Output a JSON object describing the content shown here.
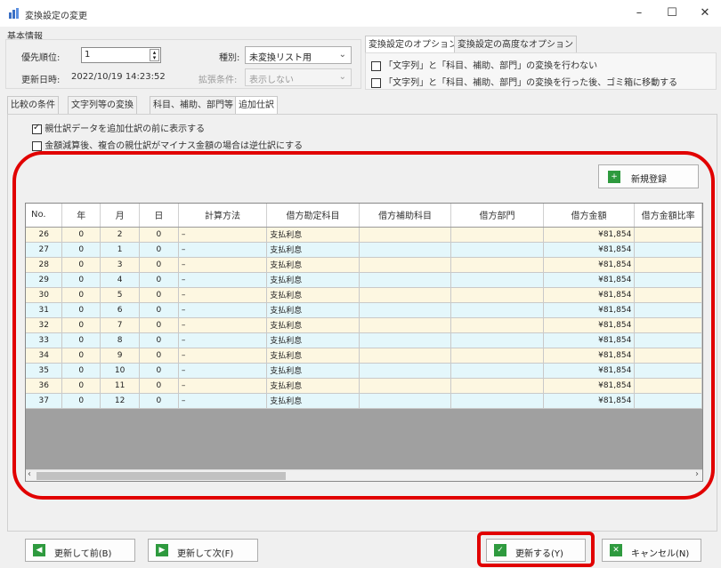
{
  "window": {
    "title": "変換設定の変更",
    "minimize": "–",
    "maximize": "☐",
    "close": "✕"
  },
  "basic": {
    "group_label": "基本情報",
    "priority_label": "優先順位:",
    "priority_value": "1",
    "updated_label": "更新日時:",
    "updated_value": "2022/10/19 14:23:52",
    "type_label": "種別:",
    "type_value": "未変換リスト用",
    "extend_label": "拡張条件:",
    "extend_value": "表示しない"
  },
  "options": {
    "tabs": [
      "変換設定のオプション",
      "変換設定の高度なオプション"
    ],
    "checks": [
      {
        "label": "「文字列」と「科目、補助、部門」の変換を行わない",
        "checked": false
      },
      {
        "label": "「文字列」と「科目、補助、部門」の変換を行った後、ゴミ箱に移動する",
        "checked": false
      }
    ]
  },
  "main_tabs": [
    "比較の条件",
    "文字列等の変換",
    "科目、補助、部門等",
    "追加仕訳"
  ],
  "panel_checks": [
    {
      "label": "親仕訳データを追加仕訳の前に表示する",
      "checked": true
    },
    {
      "label": "金額減算後、複合の親仕訳がマイナス金額の場合は逆仕訳にする",
      "checked": false
    }
  ],
  "new_button": "新規登録",
  "grid": {
    "columns": [
      "No.",
      "年",
      "月",
      "日",
      "計算方法",
      "借方勘定科目",
      "借方補助科目",
      "借方部門",
      "借方金額",
      "借方金額比率"
    ],
    "rows": [
      {
        "no": "26",
        "year": "0",
        "month": "2",
        "day": "0",
        "method": "–",
        "account": "支払利息",
        "sub": "",
        "dept": "",
        "amount": "¥81,854"
      },
      {
        "no": "27",
        "year": "0",
        "month": "1",
        "day": "0",
        "method": "–",
        "account": "支払利息",
        "sub": "",
        "dept": "",
        "amount": "¥81,854"
      },
      {
        "no": "28",
        "year": "0",
        "month": "3",
        "day": "0",
        "method": "–",
        "account": "支払利息",
        "sub": "",
        "dept": "",
        "amount": "¥81,854"
      },
      {
        "no": "29",
        "year": "0",
        "month": "4",
        "day": "0",
        "method": "–",
        "account": "支払利息",
        "sub": "",
        "dept": "",
        "amount": "¥81,854"
      },
      {
        "no": "30",
        "year": "0",
        "month": "5",
        "day": "0",
        "method": "–",
        "account": "支払利息",
        "sub": "",
        "dept": "",
        "amount": "¥81,854"
      },
      {
        "no": "31",
        "year": "0",
        "month": "6",
        "day": "0",
        "method": "–",
        "account": "支払利息",
        "sub": "",
        "dept": "",
        "amount": "¥81,854"
      },
      {
        "no": "32",
        "year": "0",
        "month": "7",
        "day": "0",
        "method": "–",
        "account": "支払利息",
        "sub": "",
        "dept": "",
        "amount": "¥81,854"
      },
      {
        "no": "33",
        "year": "0",
        "month": "8",
        "day": "0",
        "method": "–",
        "account": "支払利息",
        "sub": "",
        "dept": "",
        "amount": "¥81,854"
      },
      {
        "no": "34",
        "year": "0",
        "month": "9",
        "day": "0",
        "method": "–",
        "account": "支払利息",
        "sub": "",
        "dept": "",
        "amount": "¥81,854"
      },
      {
        "no": "35",
        "year": "0",
        "month": "10",
        "day": "0",
        "method": "–",
        "account": "支払利息",
        "sub": "",
        "dept": "",
        "amount": "¥81,854"
      },
      {
        "no": "36",
        "year": "0",
        "month": "11",
        "day": "0",
        "method": "–",
        "account": "支払利息",
        "sub": "",
        "dept": "",
        "amount": "¥81,854"
      },
      {
        "no": "37",
        "year": "0",
        "month": "12",
        "day": "0",
        "method": "–",
        "account": "支払利息",
        "sub": "",
        "dept": "",
        "amount": "¥81,854"
      }
    ]
  },
  "footer": {
    "prev": "更新して前(B)",
    "next": "更新して次(F)",
    "update": "更新する(Y)",
    "cancel": "キャンセル(N)"
  },
  "colors": {
    "highlight": "#e10000",
    "icon_green": "#2e9a3e",
    "row_odd": "#fdf7e1",
    "row_even": "#e4f7fb"
  }
}
